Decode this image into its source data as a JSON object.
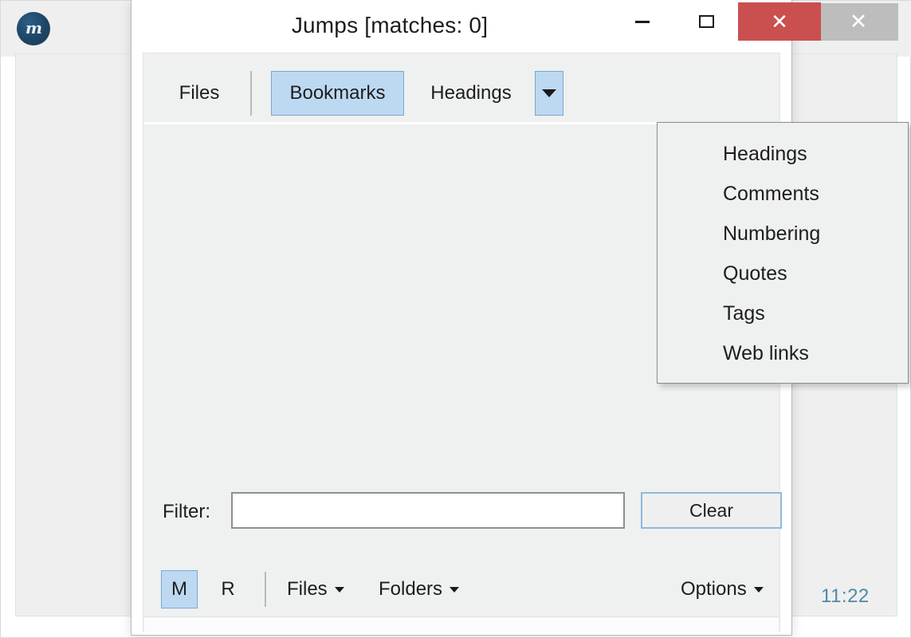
{
  "background_window": {
    "logo_icon": "app-logo-m",
    "logo_letter": "m",
    "close_icon": "✕",
    "stray_bracket": "]",
    "clock": "11:22"
  },
  "dialog": {
    "title": "Jumps [matches: 0]",
    "window_controls": {
      "minimize_icon": "minimize-icon",
      "maximize_icon": "maximize-icon",
      "close_icon": "✕",
      "close_color": "#c9504f"
    },
    "tabs": [
      {
        "label": "Files",
        "selected": false
      },
      {
        "label": "Bookmarks",
        "selected": true
      },
      {
        "label": "Headings",
        "selected": false
      }
    ],
    "tab_dropdown": {
      "icon": "chevron-down-icon",
      "open": true,
      "items": [
        "Headings",
        "Comments",
        "Numbering",
        "Quotes",
        "Tags",
        "Web links"
      ]
    },
    "filter": {
      "label": "Filter:",
      "value": "",
      "placeholder": "",
      "clear_label": "Clear"
    },
    "statusbar": {
      "mode_m": "M",
      "mode_r": "R",
      "files_label": "Files",
      "folders_label": "Folders",
      "options_label": "Options"
    },
    "accent_selected": "#bdd9f2",
    "accent_border": "#7aa7cc"
  }
}
